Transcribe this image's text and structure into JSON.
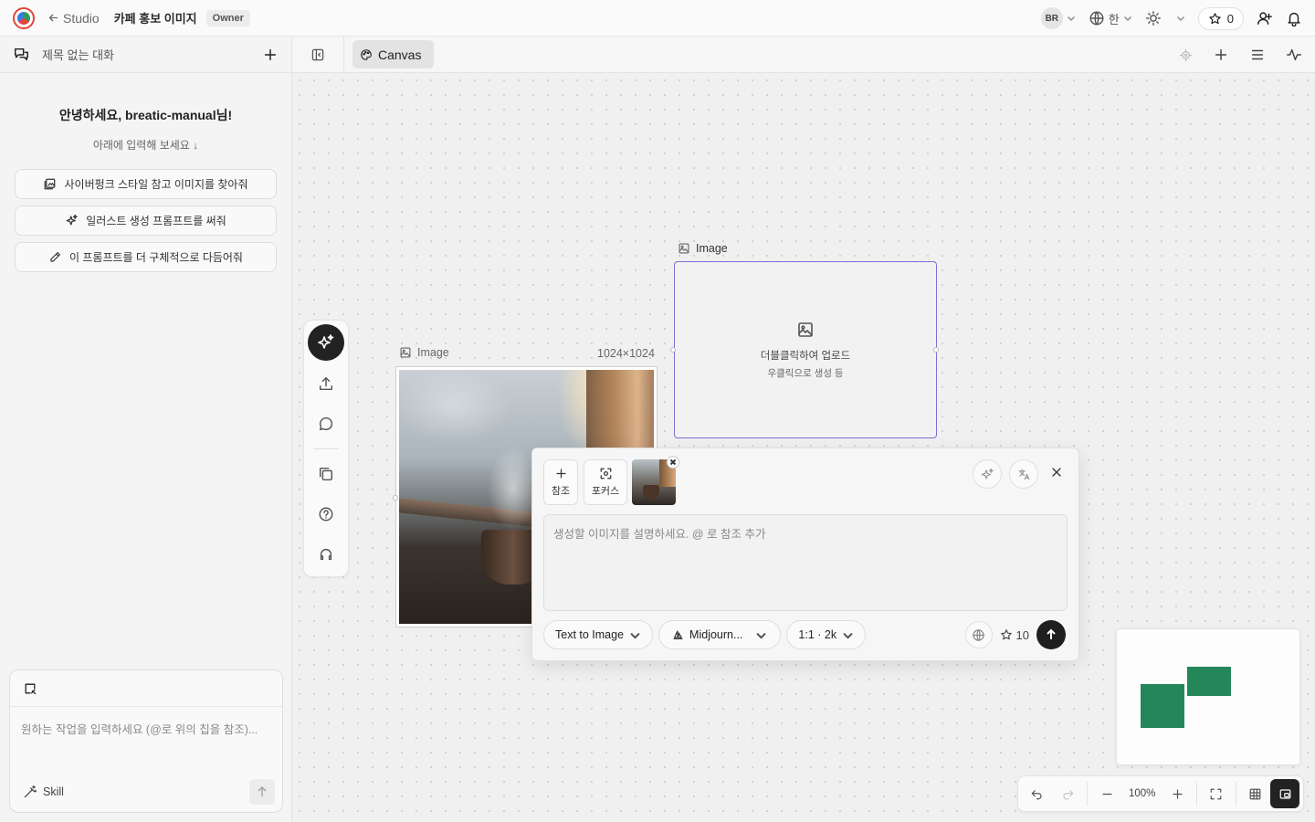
{
  "topbar": {
    "back_label": "Studio",
    "project_title": "카페 홍보 이미지",
    "role_badge": "Owner",
    "user_initials": "BR",
    "language": "한",
    "credits": "0"
  },
  "chat": {
    "title": "제목 없는 대화",
    "greeting": "안녕하세요, breatic-manual님!",
    "subtitle": "아래에 입력해 보세요 ↓",
    "suggestions": [
      {
        "label": "사이버펑크 스타일 참고 이미지를 찾아줘",
        "icon": "image-search-icon"
      },
      {
        "label": "일러스트 생성 프롬프트를 써줘",
        "icon": "sparkles-icon"
      },
      {
        "label": "이 프롬프트를 더 구체적으로 다듬어줘",
        "icon": "pencil-icon"
      }
    ],
    "composer_placeholder": "원하는 작업을 입력하세요 (@로 위의 칩을 참조)...",
    "skill_label": "Skill"
  },
  "canvas_header": {
    "tab_label": "Canvas"
  },
  "nodes": {
    "image_node": {
      "label": "Image",
      "size": "1024×1024"
    },
    "upload_node": {
      "label": "Image",
      "line1": "더블클릭하여 업로드",
      "line2": "우클릭으로 생성 등"
    }
  },
  "prompt_panel": {
    "ref_label": "참조",
    "focus_label": "포커스",
    "placeholder": "생성할 이미지를 설명하세요. @ 로 참조 추가",
    "mode": "Text to Image",
    "model": "Midjourn...",
    "ratio": "1:1 · 2k",
    "cost": "10"
  },
  "zoom": {
    "level": "100%"
  },
  "colors": {
    "accent_selection": "#7b6fd6",
    "minimap_node": "#24875a",
    "primary_dark": "#1f1f1f"
  }
}
